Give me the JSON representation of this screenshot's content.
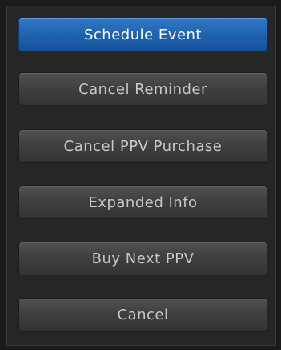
{
  "menu": {
    "items": [
      {
        "label": "Schedule Event",
        "selected": true
      },
      {
        "label": "Cancel Reminder",
        "selected": false
      },
      {
        "label": "Cancel PPV Purchase",
        "selected": false
      },
      {
        "label": "Expanded Info",
        "selected": false
      },
      {
        "label": "Buy Next PPV",
        "selected": false
      },
      {
        "label": "Cancel",
        "selected": false
      }
    ]
  },
  "colors": {
    "selected_accent": "#1f63b0",
    "button_face": "#404040",
    "background": "#1a1a1a"
  }
}
